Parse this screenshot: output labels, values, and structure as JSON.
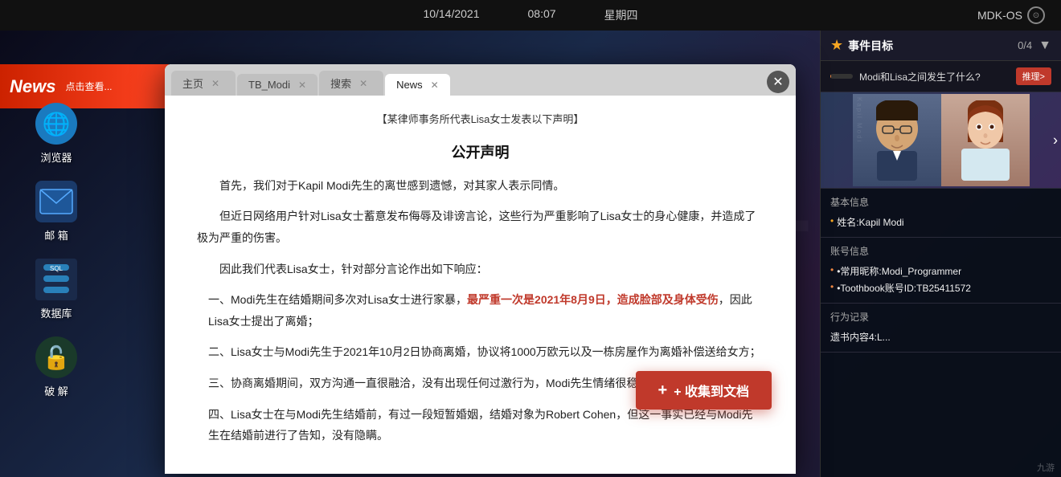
{
  "topbar": {
    "date": "10/14/2021",
    "time": "08:07",
    "weekday": "星期四",
    "os": "MDK-OS"
  },
  "desktop": {
    "icons": [
      {
        "id": "browser",
        "label": "浏览器",
        "color": "#1a7abf",
        "symbol": "🌐"
      },
      {
        "id": "email",
        "label": "邮 箱",
        "color": "#c0392b",
        "symbol": "✉"
      },
      {
        "id": "database",
        "label": "数据库",
        "color": "#2980b9",
        "symbol": "◫"
      },
      {
        "id": "crack",
        "label": "破 解",
        "color": "#27ae60",
        "symbol": "🔓"
      }
    ]
  },
  "newsbar": {
    "label": "News",
    "ticker": "点击查看..."
  },
  "browser": {
    "tabs": [
      {
        "id": "home",
        "label": "主页",
        "active": false
      },
      {
        "id": "tb_modi",
        "label": "TB_Modi",
        "active": false
      },
      {
        "id": "search",
        "label": "搜索",
        "active": false
      },
      {
        "id": "news",
        "label": "News",
        "active": true
      }
    ],
    "article": {
      "header": "【某律师事务所代表Lisa女士发表以下声明】",
      "title": "公开声明",
      "paragraphs": [
        {
          "type": "para",
          "text": "首先，我们对于Kapil Modi先生的离世感到遗憾，对其家人表示同情。"
        },
        {
          "type": "para",
          "text": "但近日网络用户针对Lisa女士蓄意发布侮辱及诽谤言论，这些行为严重影响了Lisa女士的身心健康，并造成了极为严重的伤害。"
        },
        {
          "type": "para",
          "text": "因此我们代表Lisa女士，针对部分言论作出如下响应："
        },
        {
          "type": "point",
          "text": "一、Modi先生在结婚期间多次对Lisa女士进行家暴，最严重一次是2021年8月9日，造成脸部及身体受伤，因此Lisa女士提出了离婚；",
          "highlight": "最严重一次是2021年8月9日，造成脸部及身体受伤"
        },
        {
          "type": "point",
          "text": "二、Lisa女士与Modi先生于2021年10月2日协商离婚，协议将1000万欧元以及一栋房屋作为离婚补偿送给女方；"
        },
        {
          "type": "point",
          "text": "三、协商离婚期间，双方沟通一直很融洽，没有出现任何过激行为，Modi先生情绪很稳定；"
        },
        {
          "type": "point",
          "text": "四、Lisa女士在与Modi先生结婚前，有过一段短暂婚姻，结婚对象为Robert Cohen，但这一事实已经与Modi先生在结婚前进行了告知，没有隐瞒。"
        }
      ]
    },
    "collect_btn": "+ 收集到文档"
  },
  "right_panel": {
    "event": {
      "title": "事件目标",
      "count": "0/4",
      "question": "Modi和Lisa之间发生了什么?",
      "progress_pct": 5,
      "recommend_label": "推理>"
    },
    "person": {
      "name": "Kapil Modi",
      "basic_info_title": "基本信息",
      "name_label": "•姓名:Kapil Modi",
      "account_info_title": "账号信息",
      "nickname_label": "•常用昵称:Modi_Programmer",
      "toothbook_label": "•Toothbook账号ID:TB25411572",
      "behavior_title": "行为记录",
      "behavior_item": "遗书内容4:L..."
    }
  },
  "watermark": "九游"
}
